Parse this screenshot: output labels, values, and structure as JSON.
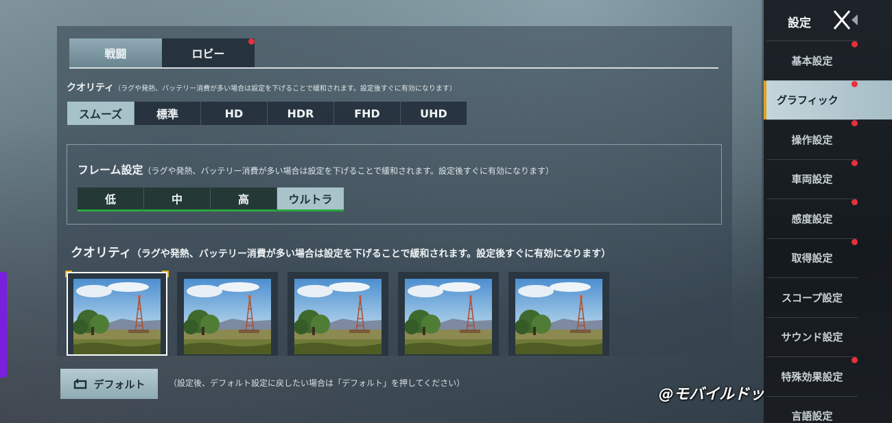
{
  "tabs": [
    {
      "label": "戦闘",
      "active": true
    },
    {
      "label": "ロビー",
      "active": false,
      "badge": true
    }
  ],
  "quality_top": {
    "title": "クオリティ",
    "note": "（ラグや発熱、バッテリー消費が多い場合は設定を下げることで緩和されます。設定後すぐに有効になります）",
    "options": [
      "スムーズ",
      "標準",
      "HD",
      "HDR",
      "FHD",
      "UHD"
    ],
    "selected": "スムーズ"
  },
  "frame": {
    "title": "フレーム設定",
    "note": "（ラグや発熱、バッテリー消費が多い場合は設定を下げることで緩和されます。設定後すぐに有効になります）",
    "options": [
      "低",
      "中",
      "高",
      "ウルトラ"
    ],
    "selected": "ウルトラ"
  },
  "quality_style": {
    "title": "クオリティ",
    "note": "（ラグや発熱、バッテリー消費が多い場合は設定を下げることで緩和されます。設定後すぐに有効になります）",
    "thumbnails": 5,
    "selected_index": 0
  },
  "default_button": {
    "label": "デフォルト",
    "icon": "reset-icon"
  },
  "default_note": "（設定後、デフォルト設定に戻したい場合は「デフォルト」を押してください）",
  "watermark": "@モバイルドットコム",
  "sidebar": {
    "title": "設定",
    "items": [
      {
        "label": "基本設定",
        "badge": true,
        "active": false
      },
      {
        "label": "グラフィック",
        "badge": true,
        "active": true
      },
      {
        "label": "操作設定",
        "badge": true,
        "active": false
      },
      {
        "label": "車両設定",
        "badge": true,
        "active": false
      },
      {
        "label": "感度設定",
        "badge": true,
        "active": false
      },
      {
        "label": "取得設定",
        "badge": true,
        "active": false
      },
      {
        "label": "スコープ設定",
        "badge": false,
        "active": false
      },
      {
        "label": "サウンド設定",
        "badge": false,
        "active": false
      },
      {
        "label": "特殊効果設定",
        "badge": true,
        "active": false
      },
      {
        "label": "言語設定",
        "badge": false,
        "active": false
      }
    ]
  },
  "colors": {
    "accent": "#e2a31c",
    "badge": "#e8303a",
    "frame_underline": "#28a83c",
    "selected": "#a8c2ca"
  }
}
